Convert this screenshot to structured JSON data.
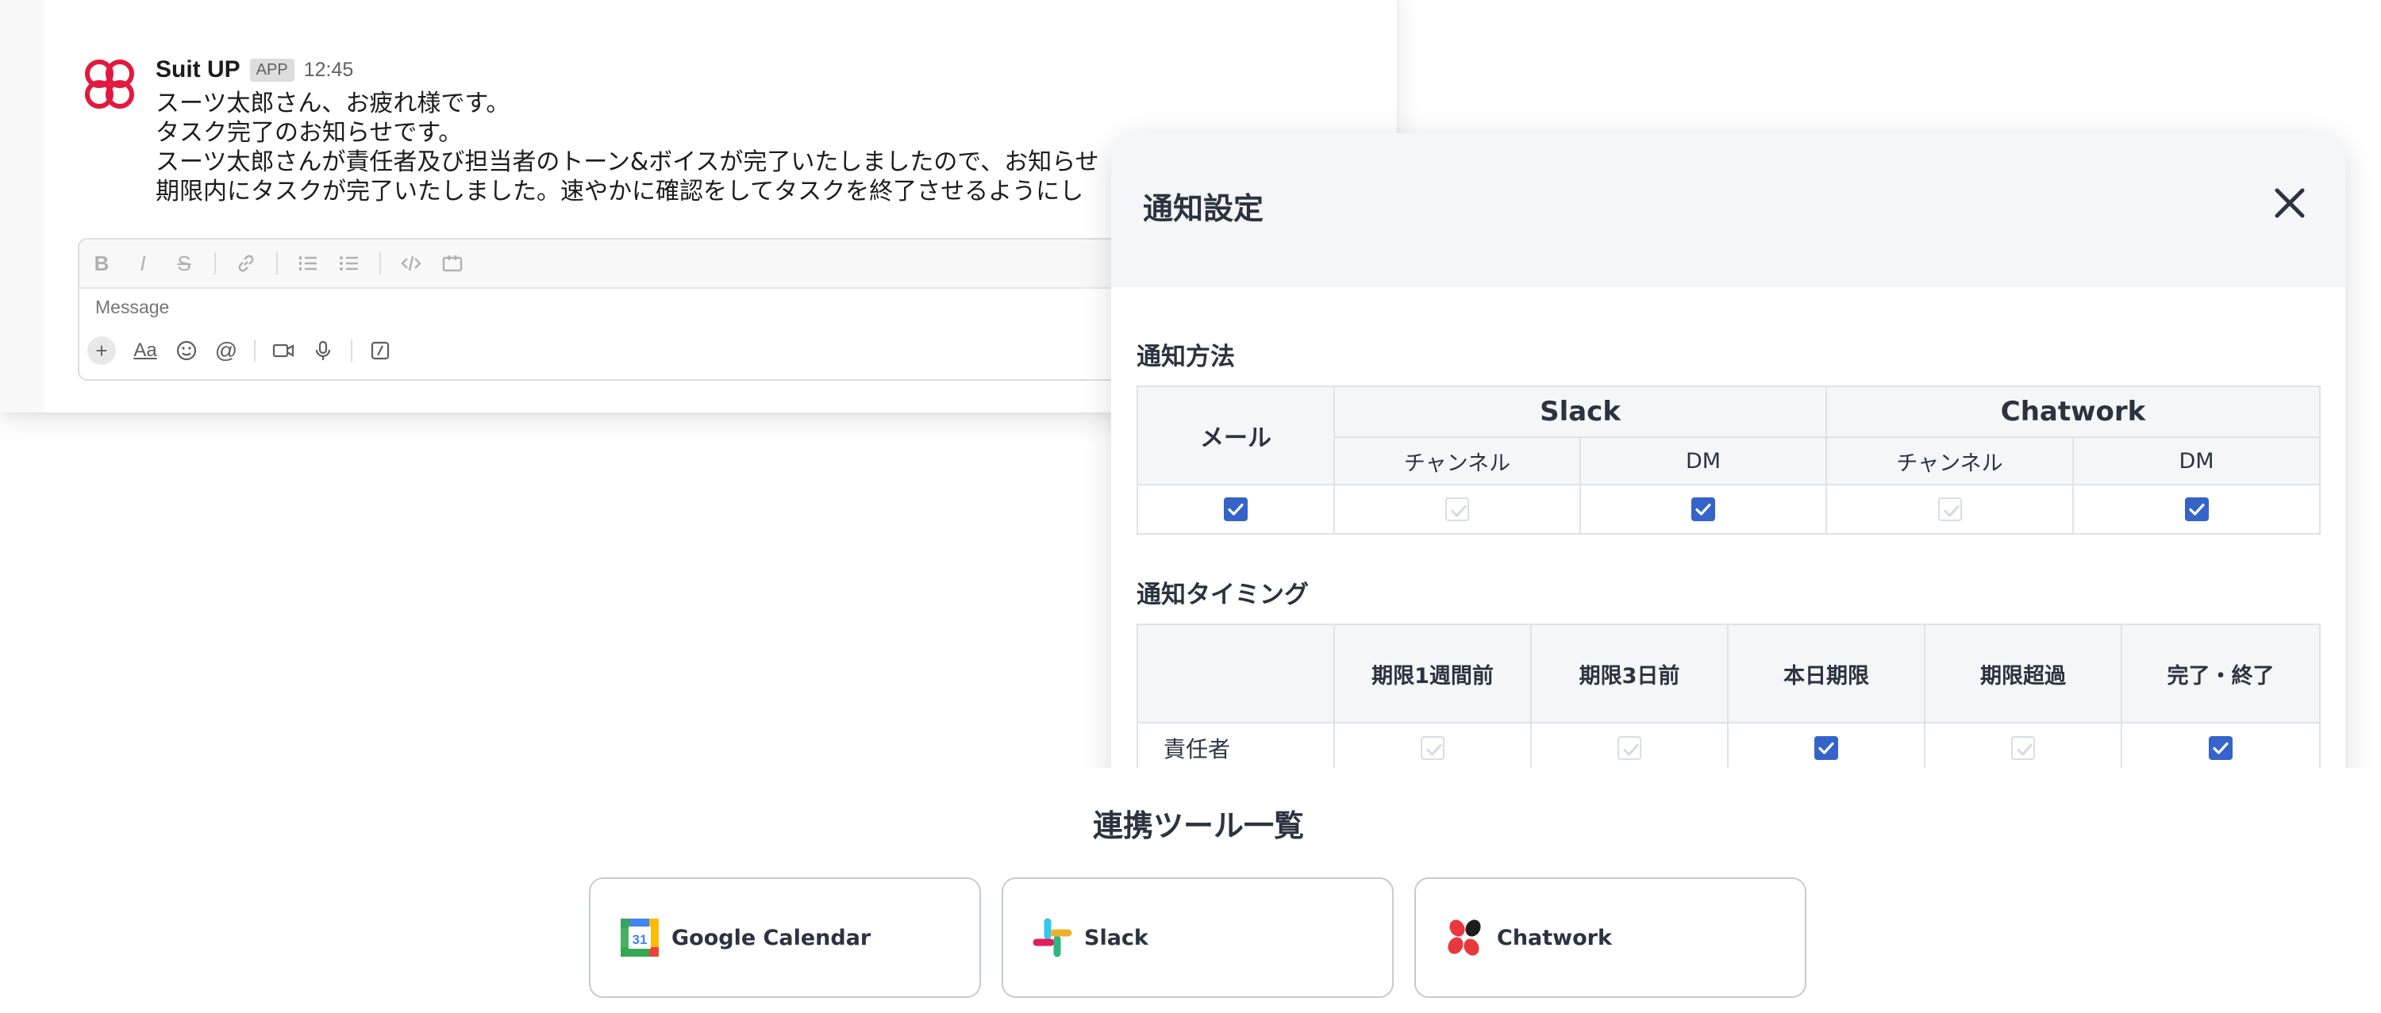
{
  "chat": {
    "author": "Suit UP",
    "badge": "APP",
    "time": "12:45",
    "lines": [
      "スーツ太郎さん、お疲れ様です。",
      "タスク完了のお知らせです。",
      "スーツ太郎さんが責任者及び担当者のトーン&ボイスが完了いたしましたので、お知らせ",
      "期限内にタスクが完了いたしました。速やかに確認をしてタスクを終了させるようにし"
    ],
    "composer": {
      "placeholder": "Message",
      "format_buttons": [
        "B",
        "I",
        "S",
        "link",
        "ordered-list",
        "bullet-list",
        "code",
        "code-block"
      ],
      "action_buttons": [
        "+",
        "Aa",
        "emoji",
        "@",
        "video",
        "mic",
        "slash"
      ]
    }
  },
  "modal": {
    "title": "通知設定",
    "method": {
      "label": "通知方法",
      "mail_header": "メール",
      "groups": [
        "Slack",
        "Chatwork"
      ],
      "sub_headers": [
        "チャンネル",
        "DM",
        "チャンネル",
        "DM"
      ],
      "checks": [
        true,
        false,
        true,
        false,
        true
      ]
    },
    "timing": {
      "label": "通知タイミング",
      "columns": [
        "期限1週間前",
        "期限3日前",
        "本日期限",
        "期限超過",
        "完了・終了"
      ],
      "rows": [
        {
          "label": "責任者",
          "checks": [
            false,
            false,
            true,
            false,
            true
          ]
        }
      ]
    }
  },
  "tools": {
    "title": "連携ツール一覧",
    "items": [
      {
        "name": "Google Calendar",
        "icon": "google-calendar-icon"
      },
      {
        "name": "Slack",
        "icon": "slack-icon"
      },
      {
        "name": "Chatwork",
        "icon": "chatwork-icon"
      }
    ]
  },
  "colors": {
    "checkbox_on": "#3563c9",
    "checkbox_off_border": "#dadde2",
    "brand_suitup": "#e2193f",
    "text_dark": "#2c3340"
  }
}
